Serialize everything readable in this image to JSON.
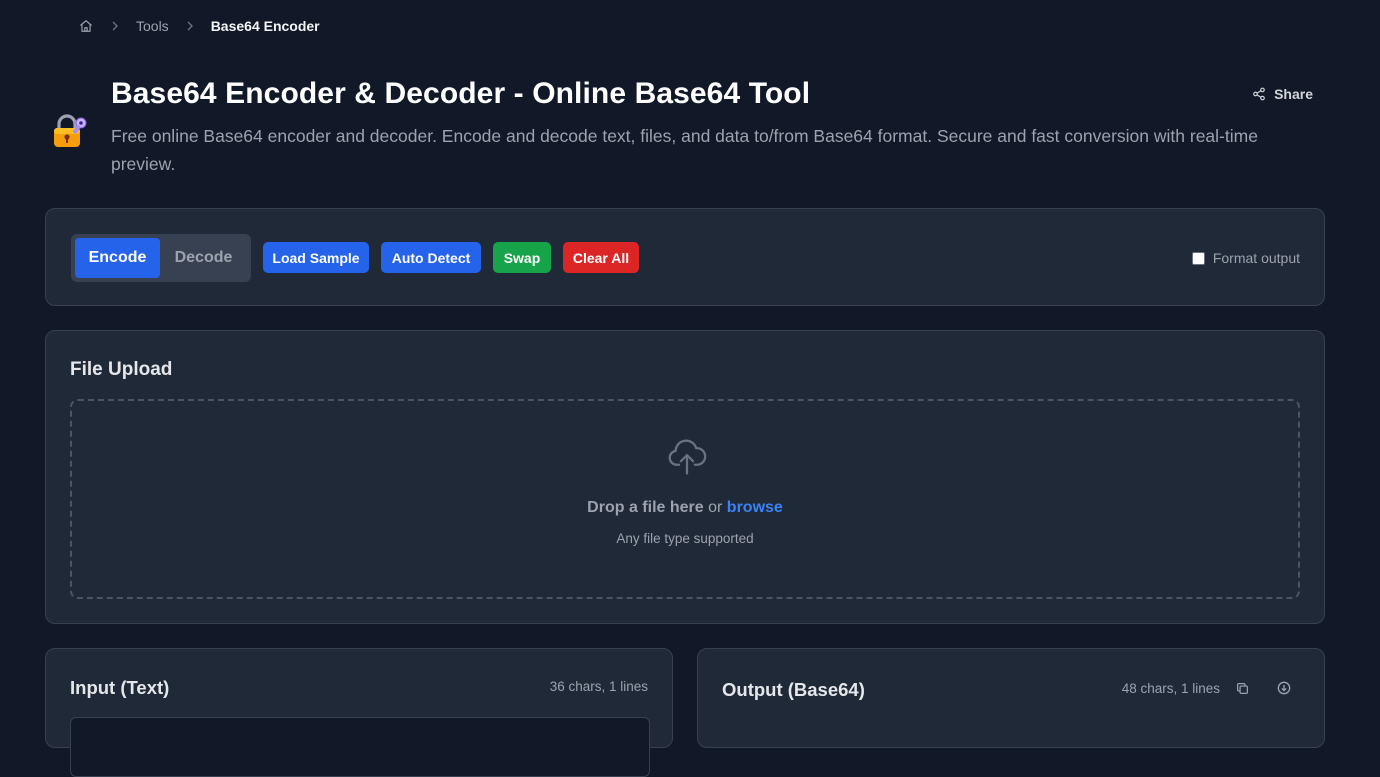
{
  "breadcrumb": {
    "home_icon": "home-icon",
    "items": [
      "Tools"
    ],
    "current": "Base64 Encoder"
  },
  "header": {
    "icon": "lock-key-emoji",
    "title": "Base64 Encoder & Decoder - Online Base64 Tool",
    "description": "Free online Base64 encoder and decoder. Encode and decode text, files, and data to/from Base64 format. Secure and fast conversion with real-time preview.",
    "share_label": "Share"
  },
  "toolbar": {
    "mode_encode": "Encode",
    "mode_decode": "Decode",
    "active_mode": "Encode",
    "load_sample": "Load Sample",
    "auto_detect": "Auto Detect",
    "swap": "Swap",
    "clear_all": "Clear All",
    "format_output_label": "Format output",
    "format_output_checked": false
  },
  "upload": {
    "title": "File Upload",
    "drop_text": "Drop a file here",
    "or_text": "or",
    "browse_text": "browse",
    "hint": "Any file type supported"
  },
  "input": {
    "title": "Input (Text)",
    "stats": "36 chars, 1 lines"
  },
  "output": {
    "title": "Output (Base64)",
    "stats": "48 chars, 1 lines"
  },
  "colors": {
    "background": "#111827",
    "card": "#1f2937",
    "primary": "#2563eb",
    "success": "#16a34a",
    "danger": "#dc2626",
    "link": "#3b82f6"
  }
}
